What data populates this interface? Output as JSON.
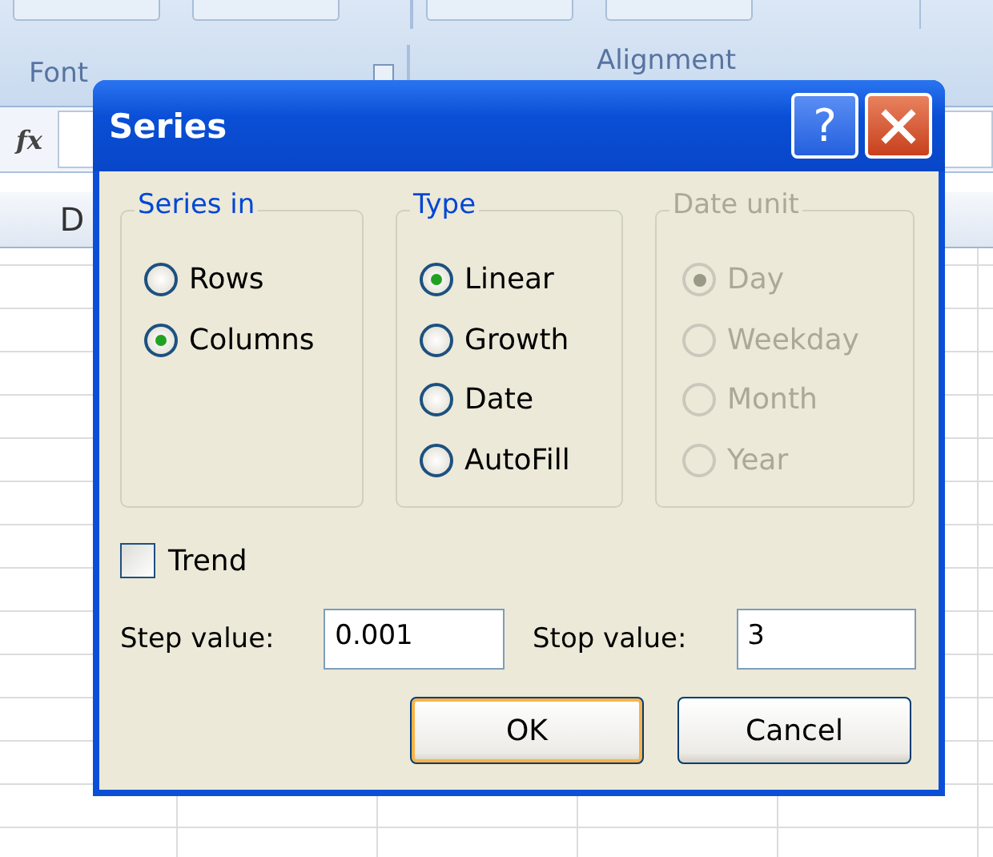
{
  "ribbon": {
    "groups": [
      {
        "label": "Font",
        "launcher": true
      },
      {
        "label": "Alignment",
        "launcher": false
      }
    ]
  },
  "formula_bar": {
    "function_label": "fx"
  },
  "sheet": {
    "column_headers": [
      "D"
    ]
  },
  "dialog": {
    "title": "Series",
    "help": "?",
    "groups": [
      {
        "title": "Series in",
        "disabled": false,
        "options": [
          {
            "label": "Rows",
            "selected": false
          },
          {
            "label": "Columns",
            "selected": true
          }
        ]
      },
      {
        "title": "Type",
        "disabled": false,
        "options": [
          {
            "label": "Linear",
            "selected": true
          },
          {
            "label": "Growth",
            "selected": false
          },
          {
            "label": "Date",
            "selected": false
          },
          {
            "label": "AutoFill",
            "selected": false
          }
        ]
      },
      {
        "title": "Date unit",
        "disabled": true,
        "options": [
          {
            "label": "Day",
            "selected": true
          },
          {
            "label": "Weekday",
            "selected": false
          },
          {
            "label": "Month",
            "selected": false
          },
          {
            "label": "Year",
            "selected": false
          }
        ]
      }
    ],
    "trend": {
      "label": "Trend",
      "checked": false
    },
    "fields": [
      {
        "label": "Step value:",
        "value": "0.001"
      },
      {
        "label": "Stop value:",
        "value": "3"
      }
    ],
    "buttons": [
      {
        "label": "OK",
        "default": true
      },
      {
        "label": "Cancel",
        "default": false
      }
    ]
  }
}
